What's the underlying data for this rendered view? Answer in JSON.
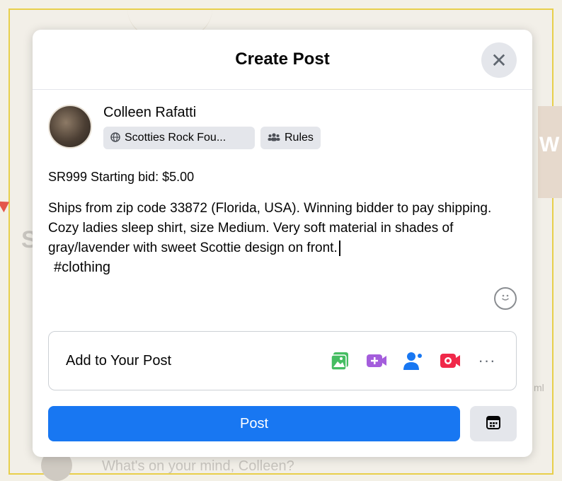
{
  "modal": {
    "title": "Create Post",
    "close_glyph": "✕"
  },
  "author": {
    "name": "Colleen Rafatti",
    "group_chip": "Scotties Rock Fou...",
    "rules_chip": "Rules"
  },
  "post": {
    "line1": "SR999  Starting bid: $5.00",
    "body": "Ships from zip code 33872 (Florida, USA).  Winning bidder to pay shipping.  Cozy ladies sleep shirt, size Medium.  Very soft material in shades of gray/lavender with sweet Scottie design on front.",
    "hashtag": "#clothing"
  },
  "add_to_post": {
    "label": "Add to Your Post",
    "icons": [
      "photo-video-icon",
      "live-video-icon",
      "tag-people-icon",
      "live-camera-icon",
      "more-icon"
    ],
    "more_glyph": "···"
  },
  "actions": {
    "post_label": "Post"
  },
  "background": {
    "composer_placeholder": "What's on your mind, Colleen?",
    "right_fragment": "ml",
    "band_fragment": "W",
    "left_fragment": "S"
  },
  "colors": {
    "accent": "#1877f2",
    "photo_icon": "#45bd62",
    "video_icon": "#a45ddc",
    "tag_icon": "#1877f2",
    "live_icon": "#f02849"
  }
}
